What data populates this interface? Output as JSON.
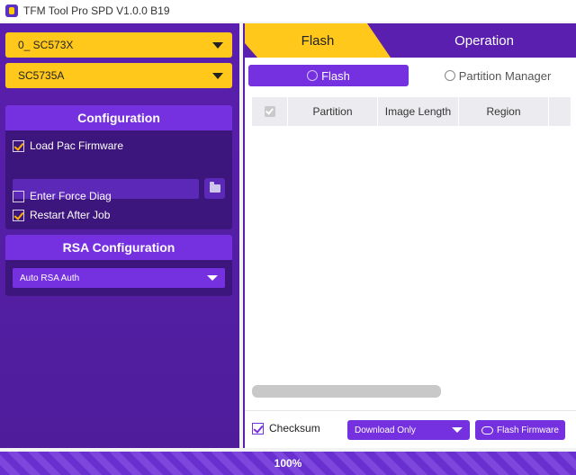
{
  "window": {
    "title": "TFM Tool Pro SPD V1.0.0 B19"
  },
  "left": {
    "port_select": "0_ SC573X",
    "chip_select": "SC5735A",
    "configuration": {
      "header": "Configuration",
      "load_pac": {
        "label": "Load Pac Firmware",
        "checked": true
      },
      "firmware_path": {
        "value": "",
        "placeholder": ""
      },
      "enter_force_diag": {
        "label": "Enter Force Diag",
        "checked": false
      },
      "restart_after_job": {
        "label": "Restart After Job",
        "checked": true
      }
    },
    "rsa": {
      "header": "RSA Configuration",
      "mode": "Auto RSA Auth"
    }
  },
  "right": {
    "tabs": [
      {
        "label": "Flash",
        "active": true
      },
      {
        "label": "Operation",
        "active": false
      }
    ],
    "subtabs": [
      {
        "label": "Flash",
        "active": true
      },
      {
        "label": "Partition Manager",
        "active": false
      }
    ],
    "table": {
      "columns": [
        "Partition",
        "Image Length",
        "Region"
      ],
      "rows": []
    },
    "footer": {
      "checksum": {
        "label": "Checksum",
        "checked": true
      },
      "download_mode": "Download Only",
      "flash_button": "Flash Firmware"
    }
  },
  "progress": {
    "value": 1.0,
    "label": "100%"
  },
  "colors": {
    "accent": "#7530e0",
    "panel": "#5a1fae",
    "highlight": "#ffc81a"
  }
}
